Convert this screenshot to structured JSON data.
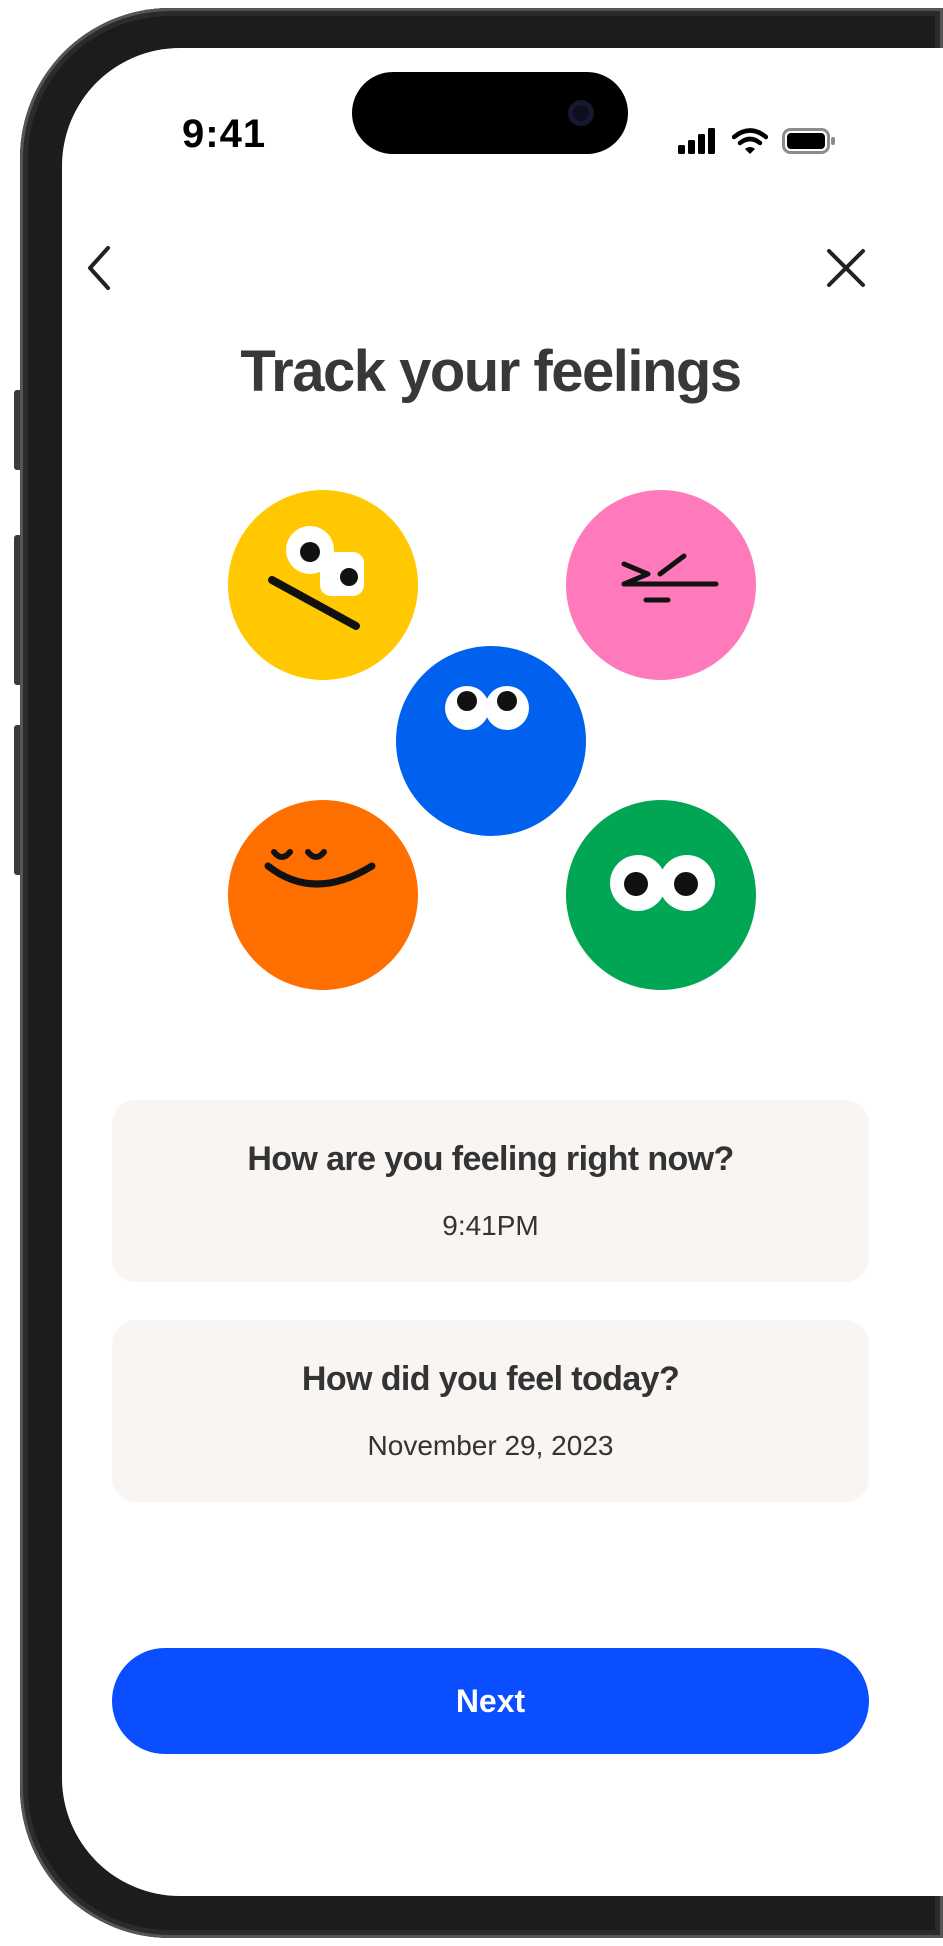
{
  "status_bar": {
    "time": "9:41",
    "icons": [
      "signal-icon",
      "wifi-icon",
      "battery-icon"
    ]
  },
  "nav": {
    "back_icon": "chevron-left-icon",
    "close_icon": "close-icon"
  },
  "title": "Track your feelings",
  "illustration": {
    "faces": [
      {
        "name": "yellow-face",
        "color": "#FFC800"
      },
      {
        "name": "pink-face",
        "color": "#FF7ABB"
      },
      {
        "name": "blue-face",
        "color": "#0061EF"
      },
      {
        "name": "orange-face",
        "color": "#FF6F00"
      },
      {
        "name": "green-face",
        "color": "#00A653"
      }
    ]
  },
  "cards": [
    {
      "title": "How are you feeling right now?",
      "subtitle": "9:41PM"
    },
    {
      "title": "How did you feel today?",
      "subtitle": "November 29, 2023"
    }
  ],
  "next_button": {
    "label": "Next"
  },
  "colors": {
    "accent": "#0A4EFF",
    "card_bg": "#F8F5F2",
    "title_text": "#383838"
  }
}
